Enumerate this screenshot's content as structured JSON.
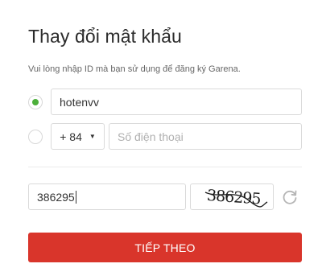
{
  "header": {
    "title": "Thay đổi mật khẩu",
    "subtitle": "Vui lòng nhập ID mà bạn sử dụng để đăng ký Garena."
  },
  "form": {
    "id_option": {
      "selected": true,
      "value": "hotenvv"
    },
    "phone_option": {
      "selected": false,
      "country_code": "+ 84",
      "phone_placeholder": "Số điện thoại"
    },
    "captcha": {
      "input_value": "386295",
      "image_text": "386295",
      "refresh_icon": "refresh-icon"
    },
    "submit_label": "TIẾP THEO"
  },
  "colors": {
    "accent": "#d9352b",
    "radio_checked": "#4caf3a",
    "border": "#dadada"
  }
}
